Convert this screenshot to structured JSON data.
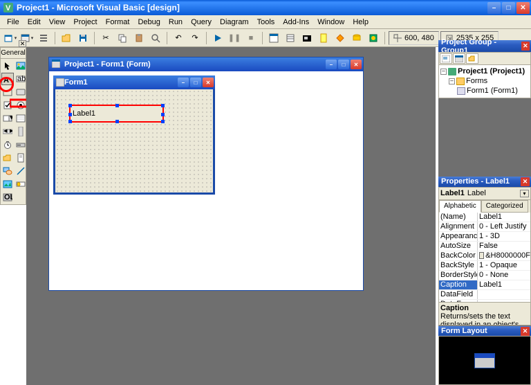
{
  "app": {
    "title": "Project1 - Microsoft Visual Basic [design]"
  },
  "menu": {
    "items": [
      "File",
      "Edit",
      "View",
      "Project",
      "Format",
      "Debug",
      "Run",
      "Query",
      "Diagram",
      "Tools",
      "Add-Ins",
      "Window",
      "Help"
    ]
  },
  "toolbar": {
    "coord1": "600, 480",
    "coord2": "2535 x 255"
  },
  "toolbox": {
    "tab": "General",
    "tools": [
      "pointer",
      "picturebox",
      "label",
      "textbox",
      "frame",
      "command",
      "checkbox",
      "option",
      "combobox",
      "listbox",
      "hscroll",
      "vscroll",
      "timer",
      "drive",
      "dirlist",
      "filelist",
      "shape",
      "line",
      "image",
      "data",
      "ole"
    ]
  },
  "designer": {
    "title": "Project1 - Form1 (Form)",
    "form_title": "Form1",
    "label_caption": "Label1"
  },
  "project_explorer": {
    "title": "Project Group - Group1",
    "root": "Project1 (Project1)",
    "folder": "Forms",
    "form": "Form1 (Form1)"
  },
  "properties": {
    "title": "Properties - Label1",
    "object_name": "Label1",
    "object_type": "Label",
    "tab_alpha": "Alphabetic",
    "tab_cat": "Categorized",
    "rows": [
      {
        "k": "(Name)",
        "v": "Label1"
      },
      {
        "k": "Alignment",
        "v": "0 - Left Justify"
      },
      {
        "k": "Appearance",
        "v": "1 - 3D"
      },
      {
        "k": "AutoSize",
        "v": "False"
      },
      {
        "k": "BackColor",
        "v": "&H8000000F",
        "swatch": "#ece9d8"
      },
      {
        "k": "BackStyle",
        "v": "1 - Opaque"
      },
      {
        "k": "BorderStyle",
        "v": "0 - None"
      },
      {
        "k": "Caption",
        "v": "Label1",
        "sel": true
      },
      {
        "k": "DataField",
        "v": ""
      },
      {
        "k": "DataFormat",
        "v": ""
      }
    ],
    "desc_title": "Caption",
    "desc_text": "Returns/sets the text displayed in an object's title bar or below an"
  },
  "form_layout": {
    "title": "Form Layout"
  }
}
